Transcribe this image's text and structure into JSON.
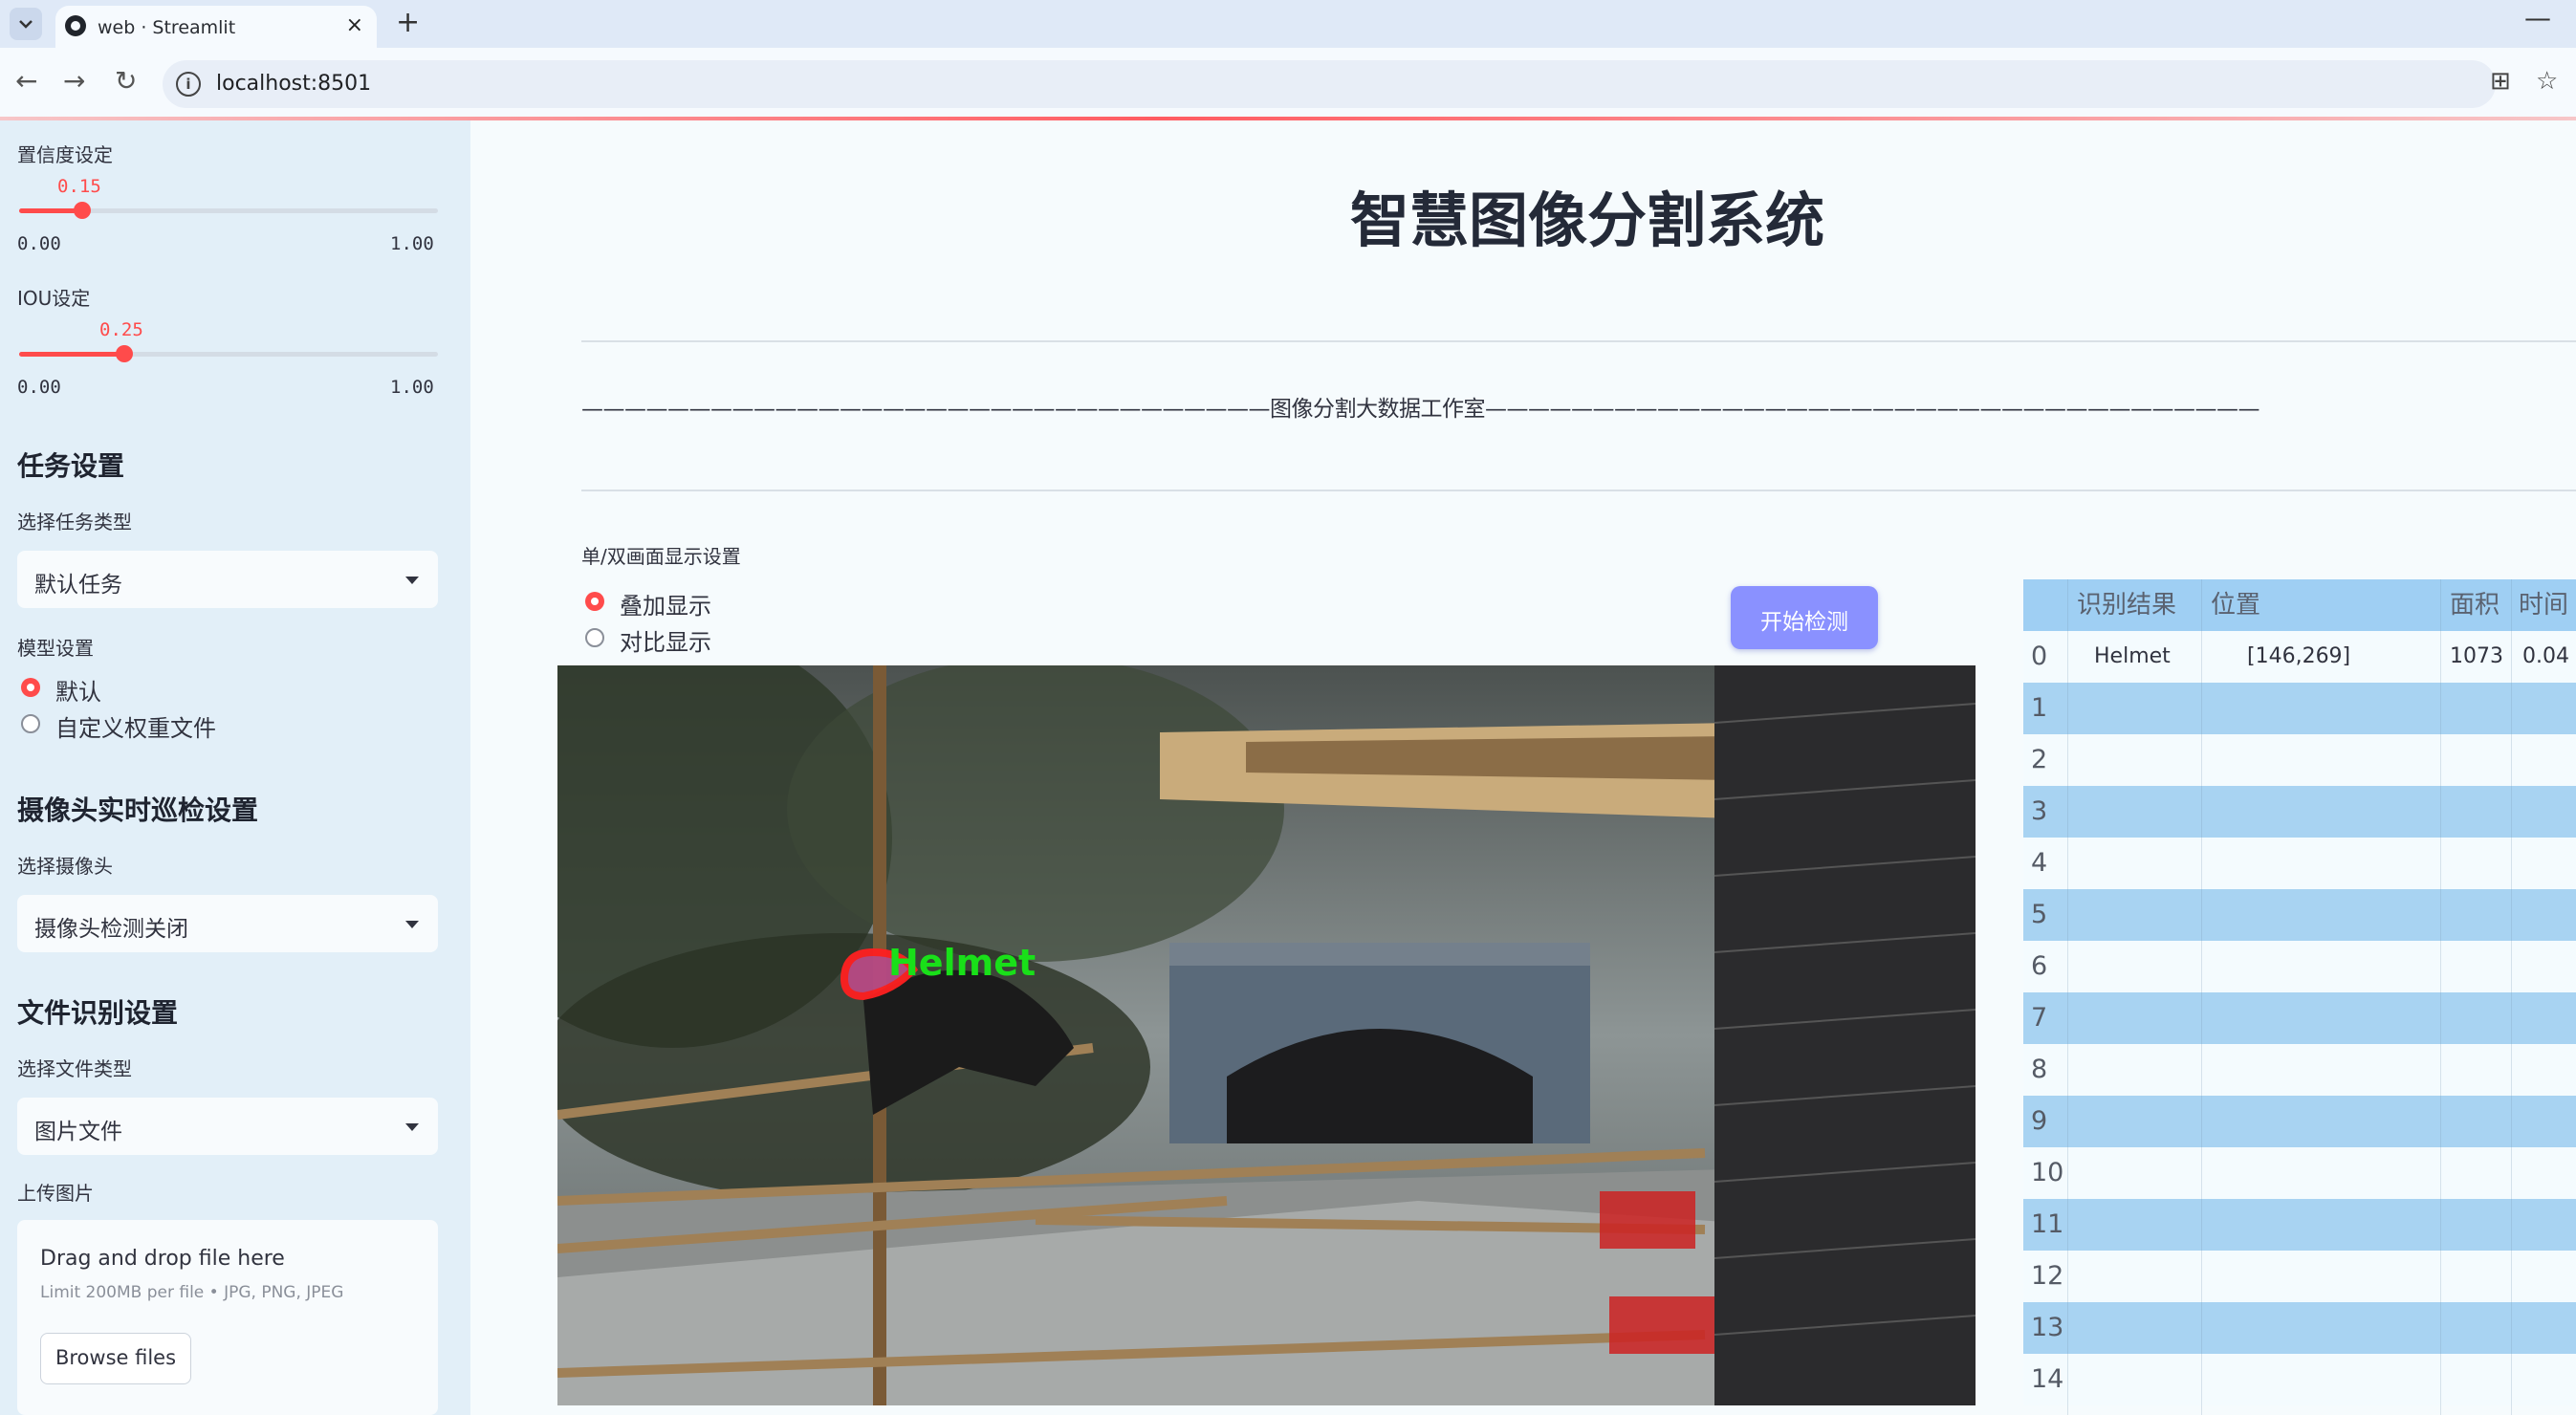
{
  "browser": {
    "tab_title": "web · Streamlit",
    "tab_close": "×",
    "new_tab": "+",
    "minimize": "—",
    "url": "localhost:8501"
  },
  "sidebar": {
    "confidence": {
      "label": "置信度设定",
      "value": "0.15",
      "value_num": 0.15,
      "min": "0.00",
      "max": "1.00"
    },
    "iou": {
      "label": "IOU设定",
      "value": "0.25",
      "value_num": 0.25,
      "min": "0.00",
      "max": "1.00"
    },
    "task_section": {
      "heading": "任务设置",
      "select_label": "选择任务类型",
      "selected": "默认任务"
    },
    "model_section": {
      "label": "模型设置",
      "options": [
        "默认",
        "自定义权重文件"
      ],
      "selected_index": 0
    },
    "camera_section": {
      "heading": "摄像头实时巡检设置",
      "select_label": "选择摄像头",
      "selected": "摄像头检测关闭"
    },
    "file_section": {
      "heading": "文件识别设置",
      "select_label": "选择文件类型",
      "selected": "图片文件"
    },
    "upload": {
      "label": "上传图片",
      "drag_text": "Drag and drop file here",
      "limit_text": "Limit 200MB per file • JPG, PNG, JPEG",
      "browse_label": "Browse files"
    }
  },
  "main": {
    "title": "智慧图像分割系统",
    "dashed_subtitle": "————————————————————————————————图像分割大数据工作室————————————————————————————————————",
    "display_label": "单/双画面显示设置",
    "display_options": [
      "叠加显示",
      "对比显示"
    ],
    "display_selected_index": 0,
    "start_button": "开始检测",
    "detection_label": "Helmet"
  },
  "results_table": {
    "columns": [
      "",
      "识别结果",
      "位置",
      "面积",
      "时间"
    ],
    "rows": [
      {
        "index": "0",
        "result": "Helmet",
        "position": "[146,269]",
        "area": "1073",
        "time": "0.04"
      },
      {
        "index": "1",
        "result": "",
        "position": "",
        "area": "",
        "time": ""
      },
      {
        "index": "2",
        "result": "",
        "position": "",
        "area": "",
        "time": ""
      },
      {
        "index": "3",
        "result": "",
        "position": "",
        "area": "",
        "time": ""
      },
      {
        "index": "4",
        "result": "",
        "position": "",
        "area": "",
        "time": ""
      },
      {
        "index": "5",
        "result": "",
        "position": "",
        "area": "",
        "time": ""
      },
      {
        "index": "6",
        "result": "",
        "position": "",
        "area": "",
        "time": ""
      },
      {
        "index": "7",
        "result": "",
        "position": "",
        "area": "",
        "time": ""
      },
      {
        "index": "8",
        "result": "",
        "position": "",
        "area": "",
        "time": ""
      },
      {
        "index": "9",
        "result": "",
        "position": "",
        "area": "",
        "time": ""
      },
      {
        "index": "10",
        "result": "",
        "position": "",
        "area": "",
        "time": ""
      },
      {
        "index": "11",
        "result": "",
        "position": "",
        "area": "",
        "time": ""
      },
      {
        "index": "12",
        "result": "",
        "position": "",
        "area": "",
        "time": ""
      },
      {
        "index": "13",
        "result": "",
        "position": "",
        "area": "",
        "time": ""
      },
      {
        "index": "14",
        "result": "",
        "position": "",
        "area": "",
        "time": ""
      }
    ]
  },
  "colors": {
    "accent": "#ff4b4b",
    "button": "#8a91ff",
    "sidebar_bg": "#e2eff8",
    "table_header": "#9fcff3",
    "detection_box": "#ff2020",
    "detection_text": "#19e019"
  }
}
